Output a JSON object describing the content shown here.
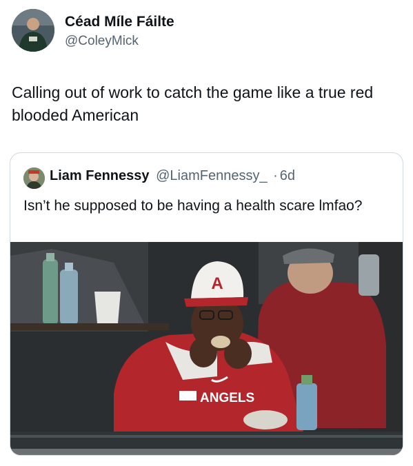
{
  "tweet": {
    "author": {
      "display_name": "Céad Míle Fáilte",
      "handle": "@ColeyMick",
      "avatar_icon": "profile-photo"
    },
    "text": "Calling out of work to catch the game like a true red blooded American"
  },
  "quoted_tweet": {
    "author": {
      "display_name": "Liam Fennessy",
      "handle": "@LiamFennessy_",
      "avatar_icon": "profile-photo"
    },
    "separator": "·",
    "time": "6d",
    "text": "Isn’t he supposed to be having a health scare lmfao?",
    "media": {
      "cap_letter": "A",
      "jersey_text": "ANGELS",
      "colors": {
        "jersey_red": "#b3262c",
        "cap_white": "#f2f0ec",
        "dark_background": "#2b2e30"
      }
    }
  }
}
